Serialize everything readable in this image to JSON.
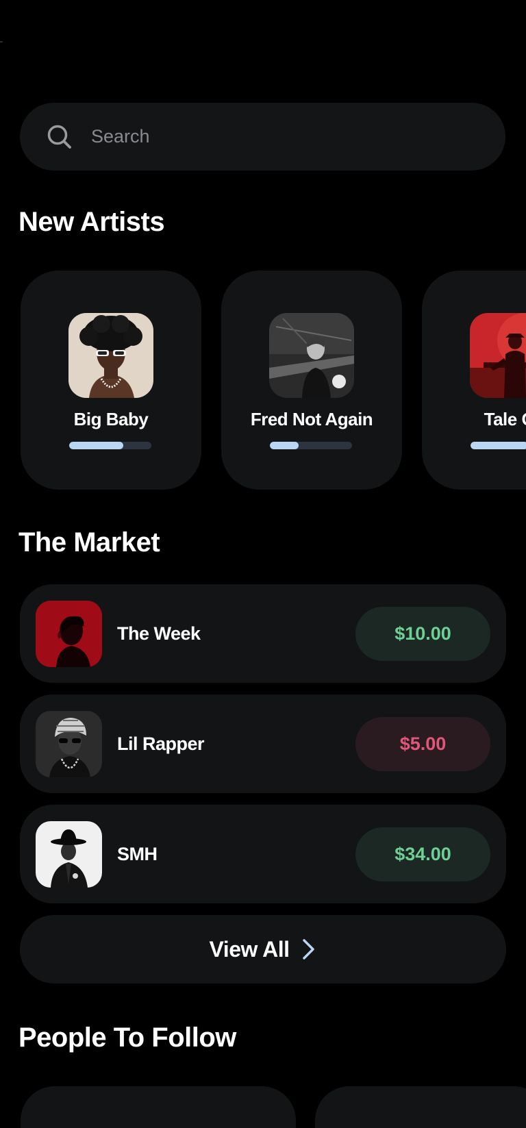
{
  "search": {
    "placeholder": "Search",
    "value": ""
  },
  "sections": {
    "new_artists": "New Artists",
    "market": "The Market",
    "people": "People To Follow"
  },
  "new_artists": [
    {
      "name": "Big Baby",
      "progress": 0.66
    },
    {
      "name": "Fred Not Again",
      "progress": 0.35
    },
    {
      "name": "Tale Of",
      "progress": 0.7
    }
  ],
  "market": [
    {
      "name": "The Week",
      "price": "$10.00",
      "trend": "up"
    },
    {
      "name": "Lil Rapper",
      "price": "$5.00",
      "trend": "down"
    },
    {
      "name": "SMH",
      "price": "$34.00",
      "trend": "up"
    }
  ],
  "view_all": {
    "label": "View All"
  },
  "colors": {
    "background": "#000000",
    "card": "#131416",
    "price_up": "#6fd095",
    "price_down": "#e0577a",
    "progress_fill": "#b9d6f5"
  }
}
